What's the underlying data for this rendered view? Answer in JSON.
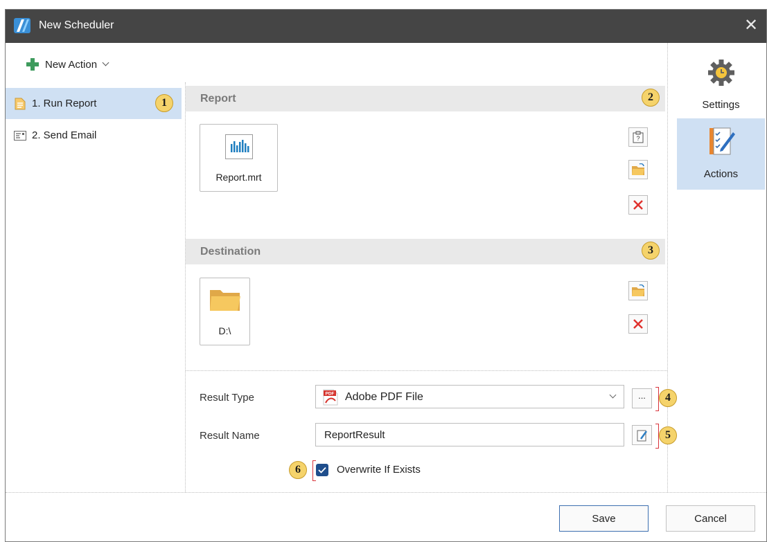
{
  "window": {
    "title": "New Scheduler",
    "close_glyph": "✕"
  },
  "toolbar": {
    "new_action_label": "New Action"
  },
  "actions": [
    {
      "label": "1. Run Report",
      "selected": true,
      "icon": "report-doc-icon",
      "badge": "1"
    },
    {
      "label": "2. Send Email",
      "selected": false,
      "icon": "email-icon"
    }
  ],
  "report_section": {
    "title": "Report",
    "badge": "2",
    "file_name": "Report.mrt",
    "tools": [
      "paste-icon",
      "open-folder-icon",
      "delete-icon"
    ]
  },
  "destination_section": {
    "title": "Destination",
    "badge": "3",
    "path": "D:\\",
    "tools": [
      "open-folder-icon",
      "delete-icon"
    ]
  },
  "result": {
    "type_label": "Result Type",
    "type_value": "Adobe PDF File",
    "type_icon_text": "PDF",
    "ellipsis": "...",
    "type_badge": "4",
    "name_label": "Result Name",
    "name_value": "ReportResult",
    "name_badge": "5",
    "overwrite_label": "Overwrite If Exists",
    "overwrite_checked": true,
    "overwrite_badge": "6"
  },
  "side_tabs": [
    {
      "label": "Settings",
      "icon": "gear-clock-icon",
      "active": false
    },
    {
      "label": "Actions",
      "icon": "checklist-pen-icon",
      "active": true
    }
  ],
  "footer": {
    "save_label": "Save",
    "cancel_label": "Cancel"
  },
  "colors": {
    "titlebar": "#454545",
    "selection": "#cfe0f3",
    "badge": "#f5d36b",
    "accent_blue": "#1f4e8c",
    "section_header": "#e9e9e9",
    "marker_red": "#d9333b"
  }
}
